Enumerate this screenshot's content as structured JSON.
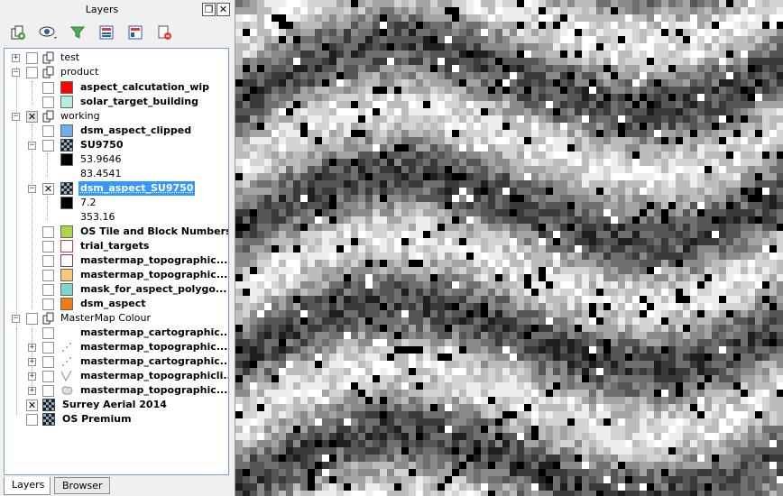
{
  "dock": {
    "title": "Layers",
    "float_glyph": "❐",
    "close_glyph": "✕"
  },
  "toolbar": {
    "icons": [
      "add-group-icon",
      "manage-visibility-icon",
      "filter-legend-icon",
      "expand-all-icon",
      "collapse-all-icon",
      "remove-layer-icon"
    ]
  },
  "tree": {
    "rows": [
      {
        "label": "test"
      },
      {
        "label": "product"
      },
      {
        "label": "aspect_calcutation_wip",
        "swatch": "#ff0000"
      },
      {
        "label": "solar_target_building",
        "swatch": "#b8ece0"
      },
      {
        "label": "working"
      },
      {
        "label": "dsm_aspect_clipped",
        "swatch": "#6fb0e8"
      },
      {
        "label": "SU9750"
      },
      {
        "label": "53.9646",
        "swatch": "#000000"
      },
      {
        "label": "83.4541"
      },
      {
        "label": "dsm_aspect_SU9750"
      },
      {
        "label": "7.2",
        "swatch": "#000000"
      },
      {
        "label": "353.16"
      },
      {
        "label": "OS Tile and Block Numbers",
        "swatch": "#a8d84a"
      },
      {
        "label": "trial_targets",
        "swatch": "#ffffff",
        "swatch_border": "#e03030"
      },
      {
        "label": "mastermap_topographic...",
        "swatch": "#ffffff",
        "swatch_border": "#6a3aa8"
      },
      {
        "label": "mastermap_topographic...",
        "swatch": "#f7c77a"
      },
      {
        "label": "mask_for_aspect_polygo...",
        "swatch": "#7ed6c8"
      },
      {
        "label": "dsm_aspect",
        "swatch": "#f07b1a"
      },
      {
        "label": "MasterMap Colour"
      },
      {
        "label": "mastermap_cartographic..."
      },
      {
        "label": "mastermap_topographic..."
      },
      {
        "label": "mastermap_cartographic..."
      },
      {
        "label": "mastermap_topographicli..."
      },
      {
        "label": "mastermap_topographic..."
      },
      {
        "label": "Surrey Aerial 2014"
      },
      {
        "label": "OS Premium"
      }
    ]
  },
  "tabs": {
    "layers": "Layers",
    "browser": "Browser"
  },
  "map": {
    "palette": [
      "#000000",
      "#1e1e1e",
      "#3a3a3a",
      "#555555",
      "#6f6f6f",
      "#8a8a8a",
      "#a3a3a3",
      "#bcbcbc",
      "#d4d4d4",
      "#eeeeee",
      "#ffffff"
    ]
  }
}
